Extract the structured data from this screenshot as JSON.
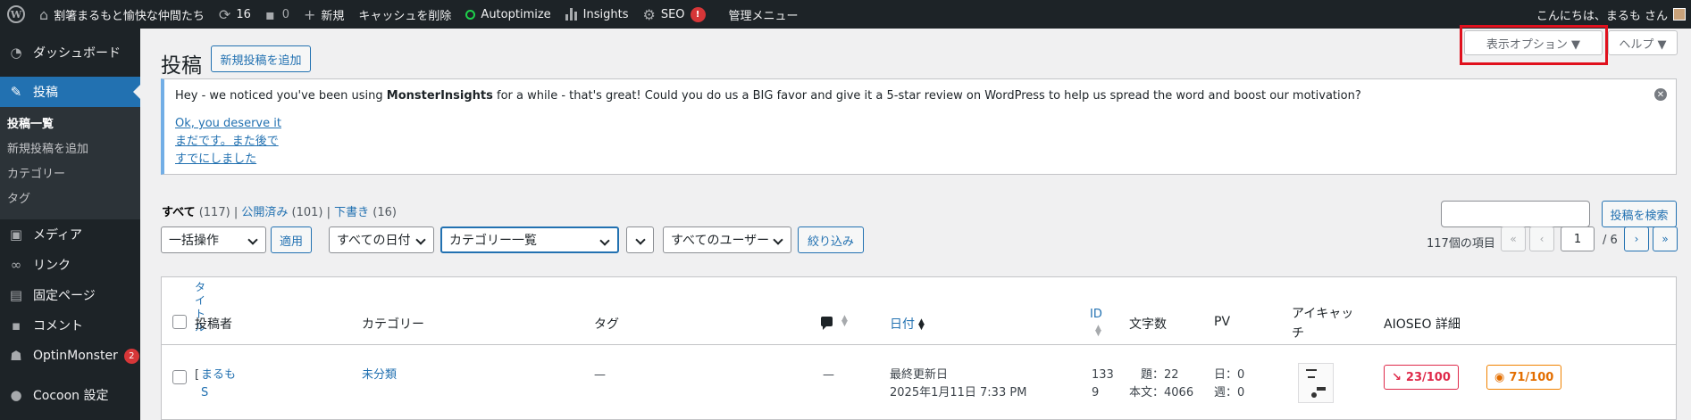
{
  "adminbar": {
    "wp_logo": "W",
    "site_name": "割箸まるもと愉快な仲間たち",
    "updates_count": "16",
    "comments_count": "0",
    "new_label": "新規",
    "cache_clear_label": "キャッシュを削除",
    "autoptimize_label": "Autoptimize",
    "insights_label": "Insights",
    "seo_label": "SEO",
    "seo_badge": "!",
    "admin_menu_label": "管理メニュー",
    "greeting": "こんにちは、まるも さん"
  },
  "sidebar": {
    "dashboard": "ダッシュボード",
    "posts": "投稿",
    "sub": {
      "all_posts": "投稿一覧",
      "add_new": "新規投稿を追加",
      "categories": "カテゴリー",
      "tags": "タグ"
    },
    "media": "メディア",
    "links": "リンク",
    "pages": "固定ページ",
    "comments": "コメント",
    "optinmonster": "OptinMonster",
    "optinmonster_badge": "2",
    "cocoon": "Cocoon 設定"
  },
  "header": {
    "title": "投稿",
    "add_new_button": "新規投稿を追加",
    "screen_options": "表示オプション ▼",
    "help": "ヘルプ ▼"
  },
  "notice": {
    "text_before": "Hey - we noticed you've been using ",
    "text_strong": "MonsterInsights",
    "text_after": " for a while - that's great! Could you do us a BIG favor and give it a 5-star review on WordPress to help us spread the word and boost our motivation?",
    "link1": "Ok, you deserve it",
    "link2": "まだです。また後で",
    "link3": "すでにしました",
    "dismiss": "✕"
  },
  "filters": {
    "all": "すべて",
    "all_count": "(117)",
    "published": "公開済み",
    "published_count": "(101)",
    "draft": "下書き",
    "draft_count": "(16)",
    "search_button": "投稿を検索"
  },
  "bulk": {
    "action": "一括操作",
    "apply": "適用",
    "dates": "すべての日付",
    "categories": "カテゴリー一覧",
    "empty_select": "",
    "users": "すべてのユーザー",
    "filter": "絞り込み"
  },
  "pagination": {
    "items": "117個の項目",
    "first": "«",
    "prev": "‹",
    "current": "1",
    "total": "/ 6",
    "next": "›",
    "last": "»"
  },
  "table": {
    "headers": {
      "title_part": "タイトル",
      "author": "投稿者",
      "categories": "カテゴリー",
      "tags": "タグ",
      "date": "日付",
      "id": "ID",
      "chars": "文字数",
      "pv": "PV",
      "eyecatch": "アイキャッチ",
      "aioseo": "AIOSEO 詳細"
    },
    "row": {
      "title_char": "[",
      "author": "まるも",
      "author_char2": "S",
      "category": "未分類",
      "tags": "—",
      "comments": "—",
      "date_label": "最終更新日",
      "date_value": "2025年1月11日 7:33 PM",
      "id_line1": "133",
      "id_line2": "9",
      "chars_title": "題：22",
      "chars_body": "本文：4066",
      "pv_day": "日：0",
      "pv_week": "週：0",
      "seo_score1": "23/100",
      "seo_score2": "71/100"
    }
  }
}
